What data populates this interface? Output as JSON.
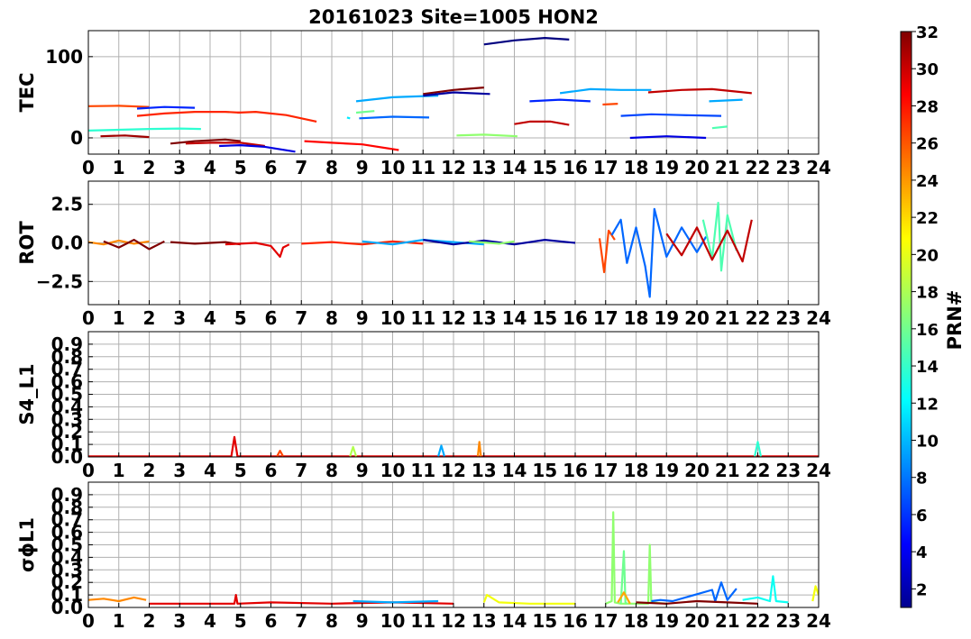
{
  "figure": {
    "title": "20161023 Site=1005 HON2",
    "colorbar": {
      "label": "PRN#",
      "ticks": [
        2,
        4,
        6,
        8,
        10,
        12,
        14,
        16,
        18,
        20,
        22,
        24,
        26,
        28,
        30,
        32
      ],
      "range": [
        1,
        32
      ],
      "colormap": "jet"
    }
  },
  "chart_data": [
    {
      "type": "line",
      "panel": "TEC",
      "ylabel": "TEC",
      "xlim": [
        0,
        24
      ],
      "ylim": [
        -20,
        132
      ],
      "x_ticks": [
        "0",
        "1",
        "2",
        "3",
        "4",
        "5",
        "6",
        "7",
        "8",
        "9",
        "10",
        "11",
        "12",
        "13",
        "14",
        "15",
        "16",
        "17",
        "18",
        "19",
        "20",
        "21",
        "22",
        "23",
        "24"
      ],
      "y_ticks": [
        {
          "value": 0,
          "label": "0"
        },
        {
          "value": 100,
          "label": "100"
        }
      ],
      "grid": true,
      "series": [
        {
          "prn": 26,
          "x": [
            0.0,
            1.0,
            2.0
          ],
          "y": [
            39,
            39.5,
            38
          ]
        },
        {
          "prn": 14,
          "x": [
            0.0,
            1.0,
            2.0,
            3.0,
            3.7
          ],
          "y": [
            9,
            10,
            11,
            11.5,
            11
          ]
        },
        {
          "prn": 31,
          "x": [
            0.4,
            1.2,
            2.0
          ],
          "y": [
            2,
            3,
            1
          ]
        },
        {
          "prn": 6,
          "x": [
            1.6,
            2.5,
            3.5
          ],
          "y": [
            36,
            38,
            37
          ]
        },
        {
          "prn": 27,
          "x": [
            1.6,
            2.5,
            3.5,
            4.5,
            5.0
          ],
          "y": [
            27,
            30,
            32,
            32,
            31
          ]
        },
        {
          "prn": 32,
          "x": [
            2.7,
            3.5,
            4.5,
            5.0
          ],
          "y": [
            -7,
            -4,
            -2,
            -4
          ]
        },
        {
          "prn": 30,
          "x": [
            3.2,
            4.0,
            5.0,
            5.8
          ],
          "y": [
            -7,
            -6,
            -6,
            -10
          ]
        },
        {
          "prn": 4,
          "x": [
            4.3,
            5.0,
            5.8,
            6.8
          ],
          "y": [
            -10,
            -9,
            -11,
            -17
          ]
        },
        {
          "prn": 27,
          "x": [
            4.9,
            5.5,
            6.5,
            7.5
          ],
          "y": [
            31,
            32,
            28,
            20
          ]
        },
        {
          "prn": 28,
          "x": [
            7.1,
            8.0,
            9.0,
            10.2
          ],
          "y": [
            -4,
            -6,
            -8,
            -15
          ]
        },
        {
          "prn": 10,
          "x": [
            8.8,
            10.0,
            11.5
          ],
          "y": [
            45,
            50,
            52
          ]
        },
        {
          "prn": 16,
          "x": [
            8.8,
            9.4
          ],
          "y": [
            31,
            33
          ]
        },
        {
          "prn": 12,
          "x": [
            8.5,
            8.6
          ],
          "y": [
            25,
            24
          ]
        },
        {
          "prn": 8,
          "x": [
            8.9,
            10.0,
            11.2
          ],
          "y": [
            24,
            26,
            25
          ]
        },
        {
          "prn": 32,
          "x": [
            11.0,
            12.0,
            13.0
          ],
          "y": [
            54,
            59,
            62
          ]
        },
        {
          "prn": 2,
          "x": [
            11.0,
            12.0,
            13.2
          ],
          "y": [
            52,
            56,
            54
          ]
        },
        {
          "prn": 1,
          "x": [
            13.0,
            14.0,
            15.0,
            15.8
          ],
          "y": [
            115,
            120,
            123,
            121
          ]
        },
        {
          "prn": 17,
          "x": [
            12.1,
            13.0,
            14.1
          ],
          "y": [
            3,
            4,
            2
          ]
        },
        {
          "prn": 30,
          "x": [
            14.0,
            14.5,
            15.2,
            15.8
          ],
          "y": [
            17,
            20,
            20,
            16
          ]
        },
        {
          "prn": 6,
          "x": [
            14.5,
            15.5,
            16.5
          ],
          "y": [
            45,
            47,
            45
          ]
        },
        {
          "prn": 10,
          "x": [
            15.5,
            16.5,
            17.5,
            18.5
          ],
          "y": [
            55,
            60,
            59,
            59
          ]
        },
        {
          "prn": 26,
          "x": [
            16.9,
            17.4
          ],
          "y": [
            41,
            42
          ]
        },
        {
          "prn": 7,
          "x": [
            17.5,
            18.5,
            19.5,
            20.8
          ],
          "y": [
            27,
            29,
            28,
            27
          ]
        },
        {
          "prn": 30,
          "x": [
            18.4,
            19.5,
            20.5,
            21.8
          ],
          "y": [
            56,
            59,
            60,
            55
          ]
        },
        {
          "prn": 4,
          "x": [
            17.8,
            19.0,
            20.3
          ],
          "y": [
            0,
            2,
            0
          ]
        },
        {
          "prn": 10,
          "x": [
            20.4,
            21.5
          ],
          "y": [
            45,
            47
          ]
        },
        {
          "prn": 15,
          "x": [
            20.5,
            21.0
          ],
          "y": [
            12,
            14
          ]
        }
      ]
    },
    {
      "type": "line",
      "panel": "ROT",
      "ylabel": "ROT",
      "xlim": [
        0,
        24
      ],
      "ylim": [
        -4,
        4
      ],
      "x_ticks": [
        "0",
        "1",
        "2",
        "3",
        "4",
        "5",
        "6",
        "7",
        "8",
        "9",
        "10",
        "11",
        "12",
        "13",
        "14",
        "15",
        "16",
        "17",
        "18",
        "19",
        "20",
        "21",
        "22",
        "23",
        "24"
      ],
      "y_ticks": [
        {
          "value": -2.5,
          "label": "−2.5"
        },
        {
          "value": 0,
          "label": "0.0"
        },
        {
          "value": 2.5,
          "label": "2.5"
        }
      ],
      "grid": true,
      "series": [
        {
          "prn": 24,
          "x": [
            0.0,
            0.5,
            1.0,
            1.5,
            2.0
          ],
          "y": [
            0.05,
            -0.1,
            0.15,
            -0.05,
            0.1
          ]
        },
        {
          "prn": 32,
          "x": [
            0.5,
            1.0,
            1.5,
            2.0,
            2.5
          ],
          "y": [
            0.1,
            -0.3,
            0.2,
            -0.4,
            0.1
          ]
        },
        {
          "prn": 32,
          "x": [
            2.7,
            3.5,
            4.5,
            5.0
          ],
          "y": [
            0.05,
            -0.05,
            0.05,
            -0.1
          ]
        },
        {
          "prn": 29,
          "x": [
            4.5,
            5.5,
            6.0,
            6.3,
            6.4,
            6.6
          ],
          "y": [
            -0.1,
            0.0,
            -0.2,
            -0.9,
            -0.3,
            -0.1
          ]
        },
        {
          "prn": 27,
          "x": [
            7.0,
            8.0,
            9.0,
            10.0,
            11.0
          ],
          "y": [
            -0.05,
            0.05,
            -0.1,
            0.1,
            -0.05
          ]
        },
        {
          "prn": 10,
          "x": [
            9.0,
            10.0,
            11.0,
            12.0,
            13.0
          ],
          "y": [
            0.1,
            -0.1,
            0.2,
            0.05,
            -0.1
          ]
        },
        {
          "prn": 2,
          "x": [
            11.0,
            12.0,
            13.0,
            14.0,
            15.0,
            16.0
          ],
          "y": [
            0.2,
            -0.1,
            0.15,
            -0.1,
            0.2,
            0.0
          ]
        },
        {
          "prn": 17,
          "x": [
            12.5,
            13.5,
            14.0
          ],
          "y": [
            0.1,
            -0.05,
            0.1
          ]
        },
        {
          "prn": 26,
          "x": [
            16.8,
            16.95,
            17.1,
            17.3
          ],
          "y": [
            0.3,
            -1.9,
            0.8,
            0.2
          ]
        },
        {
          "prn": 8,
          "x": [
            17.2,
            17.5,
            17.7,
            18.0,
            18.3,
            18.45,
            18.6,
            19.0,
            19.5,
            20.0,
            20.3
          ],
          "y": [
            0.5,
            1.5,
            -1.3,
            1.0,
            -1.5,
            -3.5,
            2.2,
            -0.9,
            1.0,
            -0.6,
            0.4
          ]
        },
        {
          "prn": 15,
          "x": [
            20.2,
            20.5,
            20.7,
            20.8,
            21.0,
            21.3
          ],
          "y": [
            1.5,
            -1.0,
            2.6,
            -1.8,
            1.8,
            -0.5
          ]
        },
        {
          "prn": 30,
          "x": [
            19.0,
            19.5,
            20.0,
            20.5,
            21.0,
            21.5,
            21.8
          ],
          "y": [
            0.6,
            -0.8,
            1.0,
            -1.1,
            0.8,
            -1.2,
            1.5
          ]
        }
      ]
    },
    {
      "type": "line",
      "panel": "S4_L1",
      "ylabel": "S4_L1",
      "xlim": [
        0,
        24
      ],
      "ylim": [
        0,
        1
      ],
      "x_ticks": [
        "0",
        "1",
        "2",
        "3",
        "4",
        "5",
        "6",
        "7",
        "8",
        "9",
        "10",
        "11",
        "12",
        "13",
        "14",
        "15",
        "16",
        "17",
        "18",
        "19",
        "20",
        "21",
        "22",
        "23",
        "24"
      ],
      "y_ticks": [
        {
          "value": 0.0,
          "label": "0.0"
        },
        {
          "value": 0.1,
          "label": "0.1"
        },
        {
          "value": 0.2,
          "label": "0.2"
        },
        {
          "value": 0.3,
          "label": "0.3"
        },
        {
          "value": 0.4,
          "label": "0.4"
        },
        {
          "value": 0.5,
          "label": "0.5"
        },
        {
          "value": 0.6,
          "label": "0.6"
        },
        {
          "value": 0.7,
          "label": "0.7"
        },
        {
          "value": 0.8,
          "label": "0.8"
        },
        {
          "value": 0.9,
          "label": "0.9"
        }
      ],
      "grid": true,
      "series": [
        {
          "prn": 29,
          "x": [
            0.0,
            4.7,
            4.8,
            4.9,
            5.0,
            24.0
          ],
          "y": [
            0.005,
            0.005,
            0.16,
            0.005,
            0.005,
            0.005
          ]
        },
        {
          "prn": 26,
          "x": [
            6.2,
            6.3,
            6.4
          ],
          "y": [
            0.005,
            0.05,
            0.005
          ]
        },
        {
          "prn": 18,
          "x": [
            8.6,
            8.7,
            8.8
          ],
          "y": [
            0.005,
            0.08,
            0.005
          ]
        },
        {
          "prn": 10,
          "x": [
            11.5,
            11.6,
            11.7
          ],
          "y": [
            0.005,
            0.09,
            0.005
          ]
        },
        {
          "prn": 24,
          "x": [
            12.8,
            12.85,
            12.9
          ],
          "y": [
            0.005,
            0.12,
            0.005
          ]
        },
        {
          "prn": 14,
          "x": [
            21.9,
            22.0,
            22.1
          ],
          "y": [
            0.005,
            0.12,
            0.005
          ]
        }
      ]
    },
    {
      "type": "line",
      "panel": "sigma_phi_L1",
      "ylabel": "σϕL1",
      "xlim": [
        0,
        24
      ],
      "ylim": [
        0,
        1
      ],
      "x_ticks": [
        "0",
        "1",
        "2",
        "3",
        "4",
        "5",
        "6",
        "7",
        "8",
        "9",
        "10",
        "11",
        "12",
        "13",
        "14",
        "15",
        "16",
        "17",
        "18",
        "19",
        "20",
        "21",
        "22",
        "23",
        "24"
      ],
      "y_ticks": [
        {
          "value": 0.0,
          "label": "0.0"
        },
        {
          "value": 0.1,
          "label": "0.1"
        },
        {
          "value": 0.2,
          "label": "0.2"
        },
        {
          "value": 0.3,
          "label": "0.3"
        },
        {
          "value": 0.4,
          "label": "0.4"
        },
        {
          "value": 0.5,
          "label": "0.5"
        },
        {
          "value": 0.6,
          "label": "0.6"
        },
        {
          "value": 0.7,
          "label": "0.7"
        },
        {
          "value": 0.8,
          "label": "0.8"
        },
        {
          "value": 0.9,
          "label": "0.9"
        }
      ],
      "grid": true,
      "series": [
        {
          "prn": 24,
          "x": [
            0.0,
            0.5,
            1.0,
            1.5,
            1.9
          ],
          "y": [
            0.06,
            0.07,
            0.05,
            0.08,
            0.06
          ]
        },
        {
          "prn": 29,
          "x": [
            2.0,
            4.0,
            4.8,
            4.85,
            4.9,
            6.0,
            8.0,
            10.0,
            12.0
          ],
          "y": [
            0.03,
            0.03,
            0.03,
            0.1,
            0.03,
            0.04,
            0.03,
            0.04,
            0.03
          ]
        },
        {
          "prn": 10,
          "x": [
            8.7,
            10.0,
            11.5
          ],
          "y": [
            0.05,
            0.04,
            0.05
          ]
        },
        {
          "prn": 20,
          "x": [
            13.0,
            13.1,
            13.5,
            14.5,
            16.0
          ],
          "y": [
            0.04,
            0.1,
            0.04,
            0.03,
            0.03
          ]
        },
        {
          "prn": 17,
          "x": [
            17.0,
            17.2,
            17.25,
            17.3,
            17.5,
            18.4,
            18.45,
            18.5,
            19.0
          ],
          "y": [
            0.03,
            0.05,
            0.76,
            0.04,
            0.03,
            0.03,
            0.5,
            0.04,
            0.03
          ]
        },
        {
          "prn": 16,
          "x": [
            17.5,
            17.6,
            17.65,
            17.7
          ],
          "y": [
            0.03,
            0.45,
            0.04,
            0.03
          ]
        },
        {
          "prn": 23,
          "x": [
            17.4,
            17.6,
            17.8
          ],
          "y": [
            0.04,
            0.12,
            0.03
          ]
        },
        {
          "prn": 8,
          "x": [
            18.5,
            18.8,
            19.2,
            20.5,
            20.6,
            20.8,
            21.0,
            21.3
          ],
          "y": [
            0.05,
            0.06,
            0.05,
            0.14,
            0.05,
            0.2,
            0.06,
            0.15
          ]
        },
        {
          "prn": 32,
          "x": [
            18.0,
            19.0,
            20.0,
            21.0,
            22.0
          ],
          "y": [
            0.04,
            0.03,
            0.05,
            0.04,
            0.03
          ]
        },
        {
          "prn": 13,
          "x": [
            21.5,
            22.0,
            22.4,
            22.5,
            22.6,
            23.0
          ],
          "y": [
            0.06,
            0.08,
            0.05,
            0.25,
            0.05,
            0.04
          ]
        },
        {
          "prn": 20,
          "x": [
            23.8,
            23.9,
            24.0
          ],
          "y": [
            0.05,
            0.17,
            0.1
          ]
        }
      ]
    }
  ]
}
